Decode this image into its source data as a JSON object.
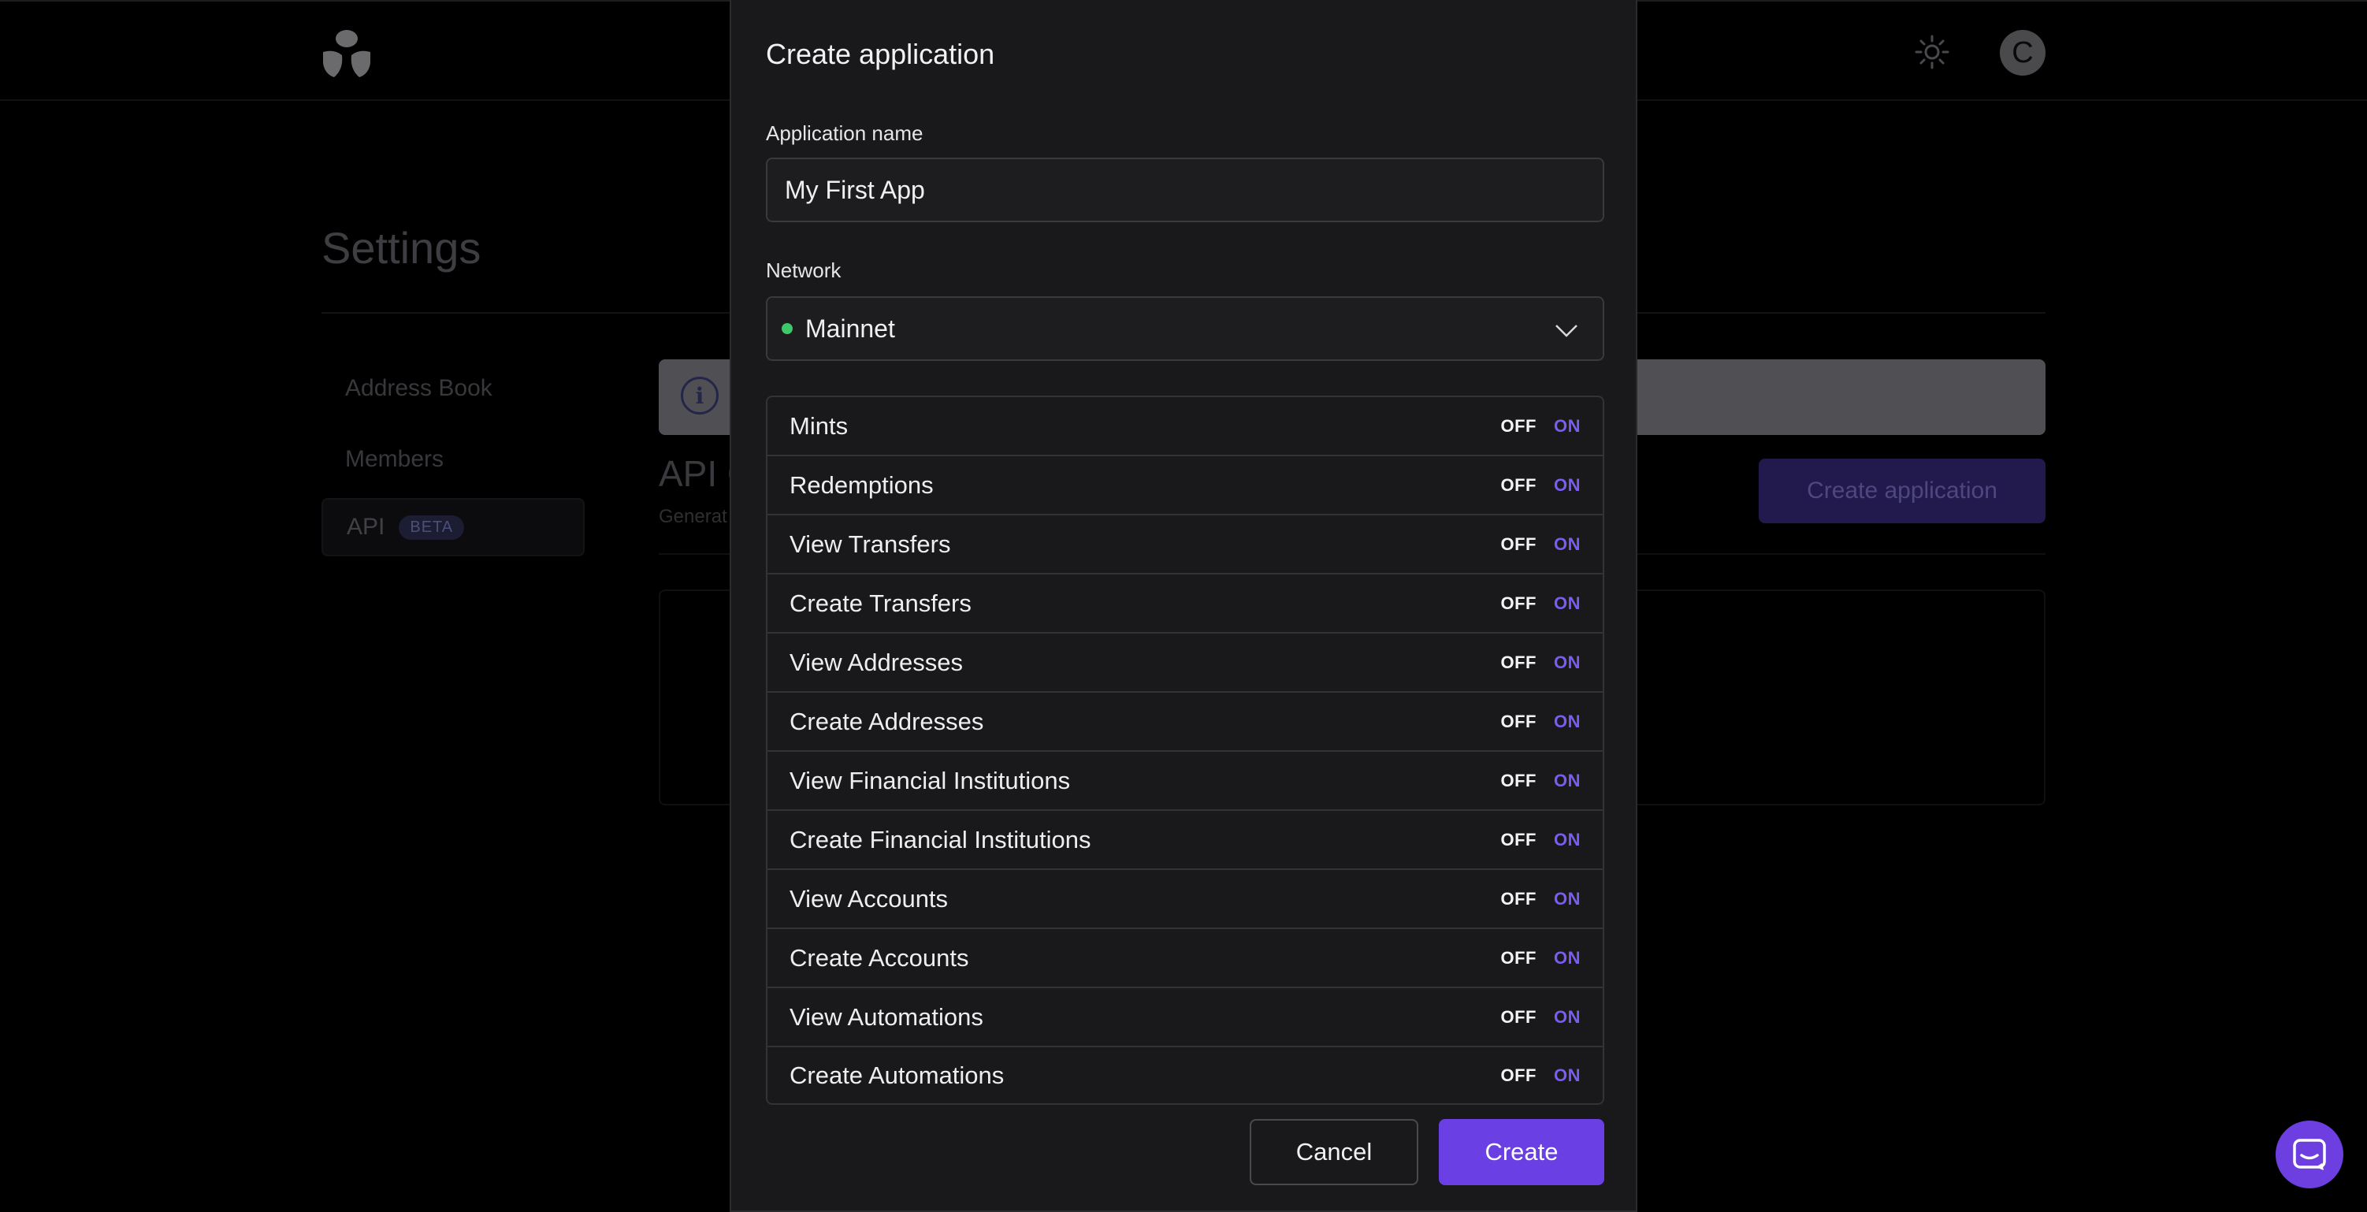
{
  "header": {
    "avatar_letter": "C",
    "theme_icon": "sun-icon",
    "logo_icon": "app-logo"
  },
  "page": {
    "title": "Settings"
  },
  "sidebar": {
    "items": [
      {
        "label": "Address Book"
      },
      {
        "label": "Members"
      },
      {
        "label": "API",
        "badge": "BETA",
        "active": true
      }
    ]
  },
  "api_section": {
    "heading": "API C",
    "subtitle": "Generat",
    "create_button": "Create application"
  },
  "modal": {
    "title": "Create application",
    "name_label": "Application name",
    "name_value": "My First App",
    "network_label": "Network",
    "network_value": "Mainnet",
    "network_status_color": "#3fc86a",
    "off_label": "OFF",
    "on_label": "ON",
    "permissions": [
      {
        "label": "Mints"
      },
      {
        "label": "Redemptions"
      },
      {
        "label": "View Transfers"
      },
      {
        "label": "Create Transfers"
      },
      {
        "label": "View Addresses"
      },
      {
        "label": "Create Addresses"
      },
      {
        "label": "View Financial Institutions"
      },
      {
        "label": "Create Financial Institutions"
      },
      {
        "label": "View Accounts"
      },
      {
        "label": "Create Accounts"
      },
      {
        "label": "View Automations"
      },
      {
        "label": "Create Automations"
      }
    ],
    "cancel_label": "Cancel",
    "create_label": "Create"
  },
  "colors": {
    "accent": "#6a3fe4",
    "on_text": "#7a5cf0",
    "background": "#000000",
    "modal_bg": "#19191b"
  }
}
